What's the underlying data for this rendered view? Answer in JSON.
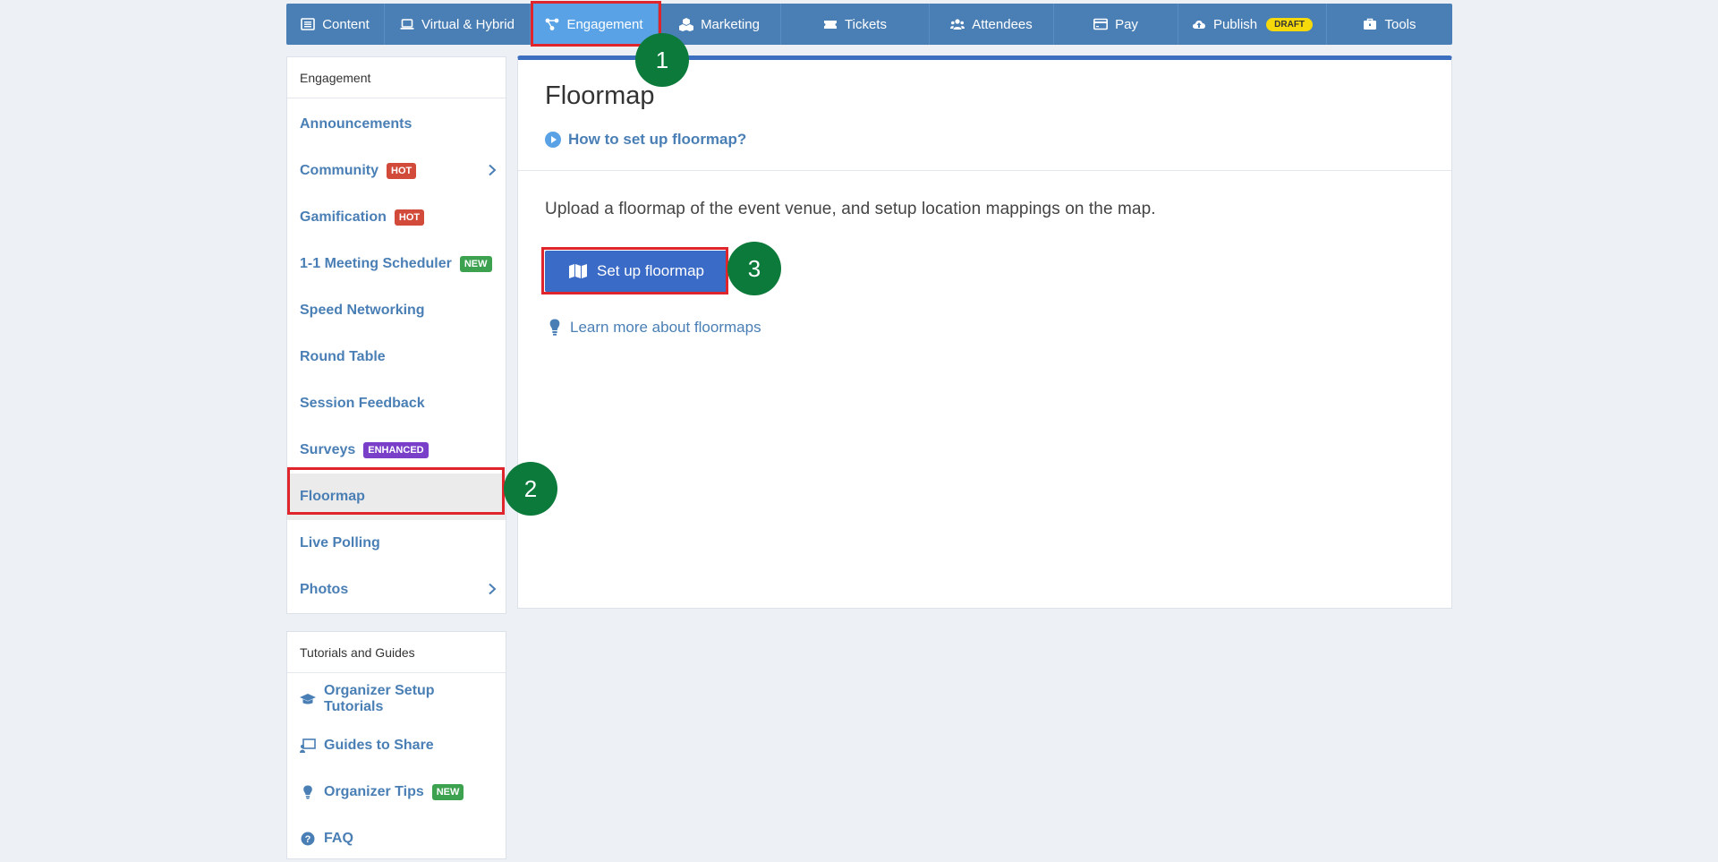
{
  "nav": {
    "items": [
      {
        "label": "Content"
      },
      {
        "label": "Virtual & Hybrid"
      },
      {
        "label": "Engagement"
      },
      {
        "label": "Marketing"
      },
      {
        "label": "Tickets"
      },
      {
        "label": "Attendees"
      },
      {
        "label": "Pay"
      },
      {
        "label": "Publish",
        "badge": "DRAFT"
      },
      {
        "label": "Tools"
      }
    ]
  },
  "markers": [
    "1",
    "2",
    "3"
  ],
  "sidebar": {
    "heading": "Engagement",
    "items": [
      {
        "label": "Announcements"
      },
      {
        "label": "Community",
        "badge": "HOT"
      },
      {
        "label": "Gamification",
        "badge": "HOT"
      },
      {
        "label": "1-1 Meeting Scheduler",
        "badge": "NEW"
      },
      {
        "label": "Speed Networking"
      },
      {
        "label": "Round Table"
      },
      {
        "label": "Session Feedback"
      },
      {
        "label": "Surveys",
        "badge": "ENHANCED"
      },
      {
        "label": "Floormap"
      },
      {
        "label": "Live Polling"
      },
      {
        "label": "Photos"
      }
    ]
  },
  "tutorials": {
    "heading": "Tutorials and Guides",
    "items": [
      {
        "label": "Organizer Setup Tutorials"
      },
      {
        "label": "Guides to Share"
      },
      {
        "label": "Organizer Tips",
        "badge": "NEW"
      },
      {
        "label": "FAQ"
      }
    ]
  },
  "main": {
    "title": "Floormap",
    "help_link": "How to set up floormap?",
    "description": "Upload a floormap of the event venue, and setup location mappings on the map.",
    "setup_button": "Set up floormap",
    "learn_link": "Learn more about floormaps"
  },
  "colors": {
    "nav_bg": "#4a7fb5",
    "nav_active": "#5aa2e6",
    "primary": "#3a6bc6",
    "link": "#4a7fb5",
    "highlight": "#e0242b",
    "marker": "#0b7a3a"
  }
}
